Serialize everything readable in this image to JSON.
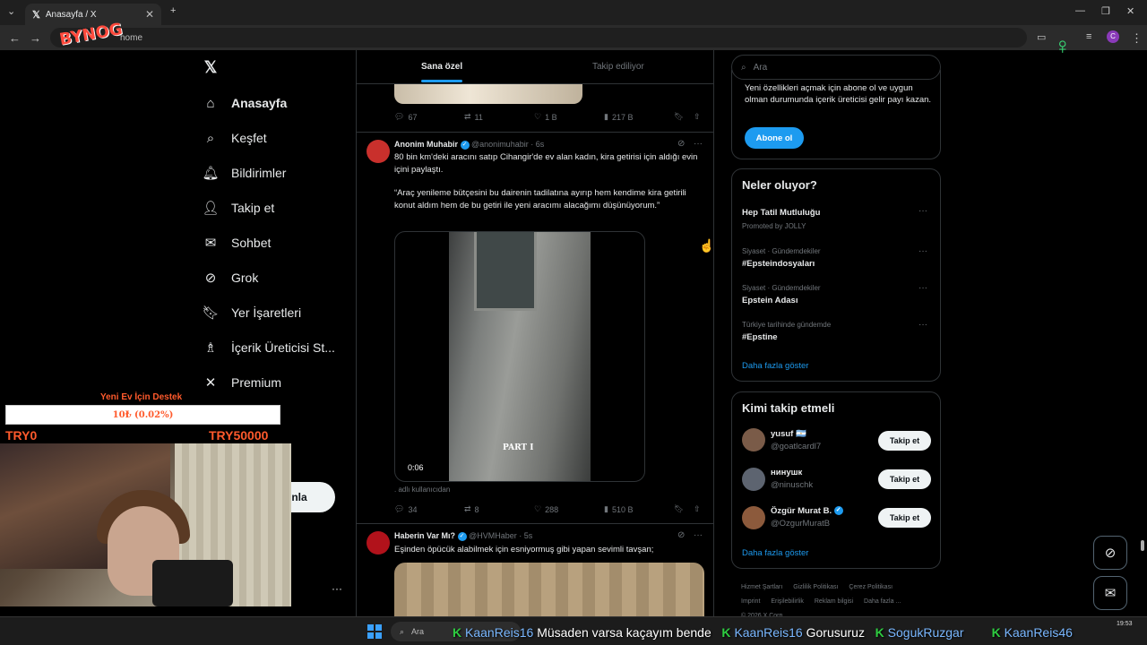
{
  "browser": {
    "tab_title": "Anasayfa / X",
    "url": "home",
    "profile_initial": "C"
  },
  "overlay": {
    "logo": "BYNOG",
    "donation_title": "Yeni Ev İçin Destek",
    "donation_progress": "10₺ (0.02%)",
    "donation_progress_fraction": 0.0002,
    "range_min": "TRY0",
    "range_max": "TRY50000"
  },
  "nav": {
    "items": [
      {
        "label": "Anasayfa",
        "icon": "home-icon"
      },
      {
        "label": "Keşfet",
        "icon": "search-icon"
      },
      {
        "label": "Bildirimler",
        "icon": "bell-icon"
      },
      {
        "label": "Takip et",
        "icon": "person-add-icon"
      },
      {
        "label": "Sohbet",
        "icon": "mail-icon"
      },
      {
        "label": "Grok",
        "icon": "grok-icon"
      },
      {
        "label": "Yer İşaretleri",
        "icon": "bookmark-icon"
      },
      {
        "label": "İçerik Üreticisi St...",
        "icon": "creator-icon"
      },
      {
        "label": "Premium",
        "icon": "x-icon"
      }
    ],
    "post_label": "nla",
    "more_dots": "···"
  },
  "feed": {
    "tabs": [
      "Sana özel",
      "Takip ediliyor"
    ],
    "prev_stats": {
      "replies": "67",
      "reposts": "11",
      "likes": "1 B",
      "views": "217 B"
    },
    "tweet1": {
      "name": "Anonim Muhabir",
      "handle": "@anonimuhabir",
      "time": "· 6s",
      "text1": "80 bin km'deki aracını satıp Cihangir'de ev alan kadın, kira getirisi için aldığı evin içini paylaştı.",
      "text2": "“Araç yenileme bütçesini bu dairenin tadilatına ayırıp hem kendime kira getirili konut aldım hem de bu getiri ile yeni aracımı alacağımı düşünüyorum.”",
      "video_label": "PART I",
      "video_time": "0:06",
      "mention": ". adlı kullanıcıdan",
      "stats": {
        "replies": "34",
        "reposts": "8",
        "likes": "288",
        "views": "510 B"
      }
    },
    "tweet2": {
      "name": "Haberin Var Mı?",
      "handle": "@HVMHaber",
      "time": "· 5s",
      "text": "Eşinden öpücük alabilmek için esniyormuş gibi yapan sevimli tavşan;"
    }
  },
  "right": {
    "search_placeholder": "Ara",
    "premium_text": "Yeni özellikleri açmak için abone ol ve uygun olman durumunda içerik üreticisi gelir payı kazan.",
    "subscribe": "Abone ol",
    "trends_title": "Neler oluyor?",
    "trends": [
      {
        "meta": "",
        "name": "Hep Tatil Mutluluğu",
        "sub": "Promoted by JOLLY"
      },
      {
        "meta": "Siyaset · Gündemdekiler",
        "name": "#Epsteindosyaları"
      },
      {
        "meta": "Siyaset · Gündemdekiler",
        "name": "Epstein Adası"
      },
      {
        "meta": "Türkiye tarihinde gündemde",
        "name": "#Epstine"
      }
    ],
    "show_more": "Daha fazla göster",
    "who_title": "Kimi takip etmeli",
    "who": [
      {
        "name": "yusuf 🇦🇷",
        "handle": "@goatlcardl7",
        "button": "Takip et"
      },
      {
        "name": "нинушк",
        "handle": "@ninuschk",
        "button": "Takip et"
      },
      {
        "name": "Özgür Murat B.",
        "handle": "@OzgurMuratB",
        "button": "Takip et"
      }
    ],
    "footer": [
      "Hizmet Şartları",
      "Gizlilik Politikası",
      "Çerez Politikası",
      "Imprint",
      "Erişilebilirlik",
      "Reklam bilgisi",
      "Daha fazla ...",
      "© 2026 X Corp."
    ]
  },
  "taskbar": {
    "search": "Ara",
    "chat": [
      {
        "user": "KaanReis16",
        "msg": "Müsaden varsa kaçayım bende"
      },
      {
        "user": "KaanReis16",
        "msg": "Gorusuruz"
      },
      {
        "user": "SogukRuzgar",
        "msg": ""
      },
      {
        "user": "KaanReis46",
        "msg": ""
      }
    ],
    "clock": "19:53"
  },
  "colors": {
    "accent": "#1d9bf0",
    "donation": "#ff5a2c",
    "chat_k": "#2ecc40"
  }
}
